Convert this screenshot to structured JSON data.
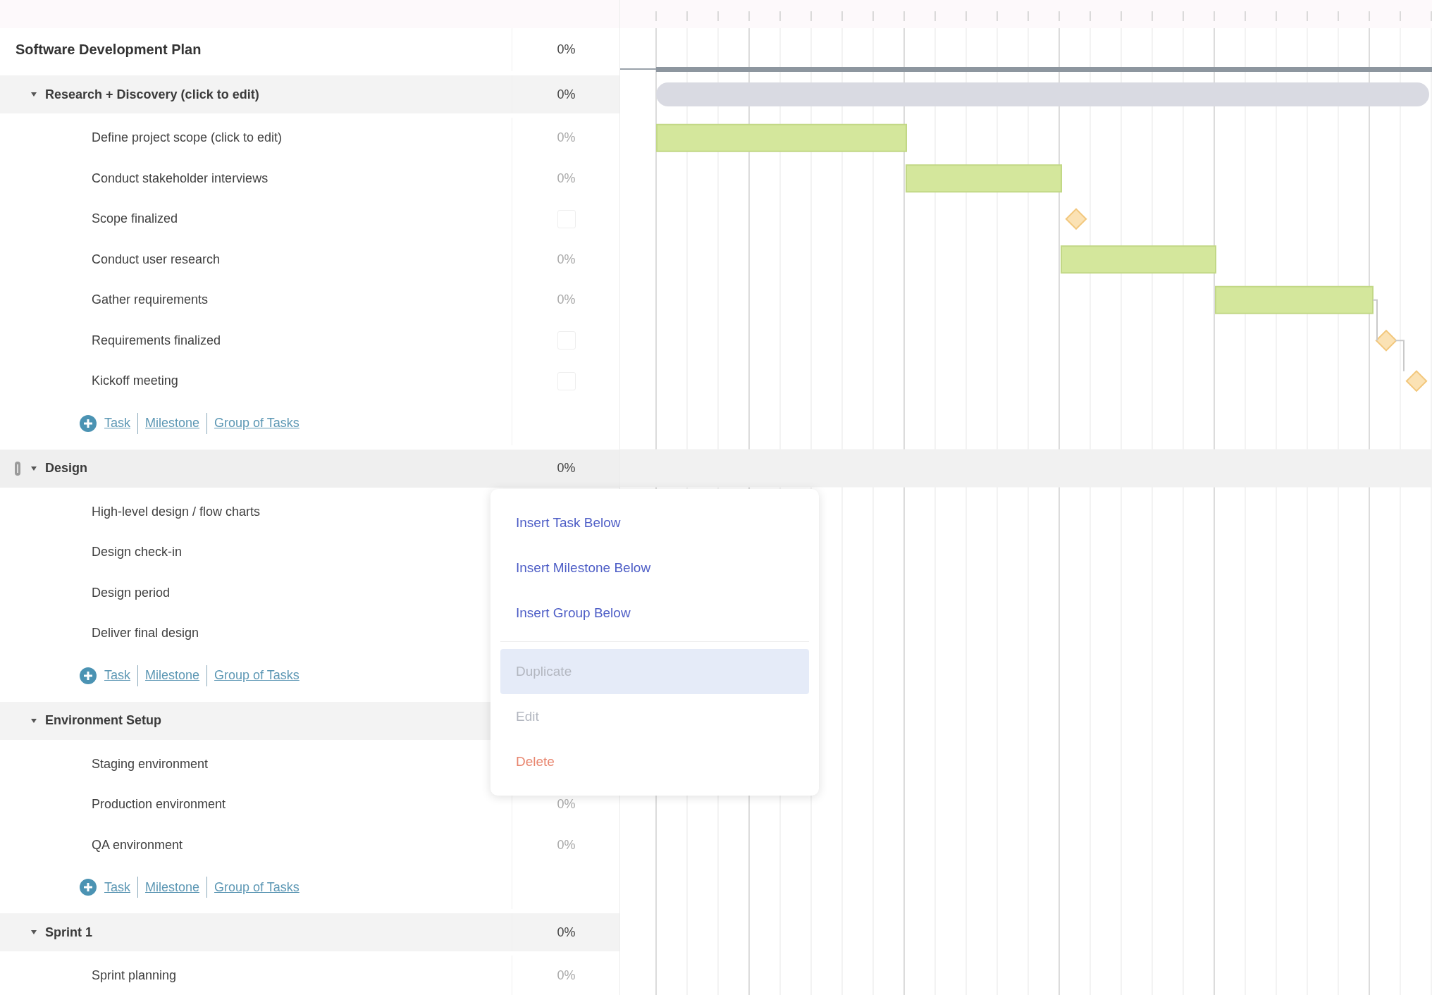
{
  "plan": {
    "title": "Software Development Plan",
    "percent": "0%"
  },
  "groups": [
    {
      "name": "Research + Discovery (click to edit)",
      "percent": "0%",
      "expanded": true,
      "selected": false,
      "tasks": [
        {
          "name": "Define project scope (click to edit)",
          "kind": "task",
          "percent": "0%"
        },
        {
          "name": "Conduct stakeholder interviews",
          "kind": "task",
          "percent": "0%"
        },
        {
          "name": "Scope finalized",
          "kind": "milestone",
          "done": false
        },
        {
          "name": "Conduct user research",
          "kind": "task",
          "percent": "0%"
        },
        {
          "name": "Gather requirements",
          "kind": "task",
          "percent": "0%"
        },
        {
          "name": "Requirements finalized",
          "kind": "milestone",
          "done": false
        },
        {
          "name": "Kickoff meeting",
          "kind": "milestone",
          "done": false
        }
      ],
      "add_links": [
        "Task",
        "Milestone",
        "Group of Tasks"
      ]
    },
    {
      "name": "Design",
      "percent": "0%",
      "expanded": true,
      "selected": true,
      "tasks": [
        {
          "name": "High-level design / flow charts",
          "kind": "task"
        },
        {
          "name": "Design check-in",
          "kind": "task"
        },
        {
          "name": "Design period",
          "kind": "task"
        },
        {
          "name": "Deliver final design",
          "kind": "task"
        }
      ],
      "add_links": [
        "Task",
        "Milestone",
        "Group of Tasks"
      ]
    },
    {
      "name": "Environment Setup",
      "expanded": true,
      "selected": false,
      "tasks": [
        {
          "name": "Staging environment",
          "kind": "task"
        },
        {
          "name": "Production environment",
          "kind": "task",
          "percent": "0%"
        },
        {
          "name": "QA environment",
          "kind": "task",
          "percent": "0%"
        }
      ],
      "add_links": [
        "Task",
        "Milestone",
        "Group of Tasks"
      ]
    },
    {
      "name": "Sprint 1",
      "percent": "0%",
      "expanded": true,
      "selected": false,
      "tasks": [
        {
          "name": "Sprint planning",
          "kind": "task",
          "percent": "0%"
        }
      ]
    }
  ],
  "context_menu": {
    "items": [
      {
        "label": "Insert Task Below",
        "kind": "action",
        "selected": false,
        "separated": false
      },
      {
        "label": "Insert Milestone Below",
        "kind": "action",
        "selected": false,
        "separated": false
      },
      {
        "label": "Insert Group Below",
        "kind": "action",
        "selected": false,
        "separated": false
      },
      {
        "label": "Duplicate",
        "kind": "muted",
        "selected": true,
        "separated": true
      },
      {
        "label": "Edit",
        "kind": "muted",
        "selected": false,
        "separated": false
      },
      {
        "label": "Delete",
        "kind": "danger",
        "selected": false,
        "separated": false
      }
    ]
  }
}
